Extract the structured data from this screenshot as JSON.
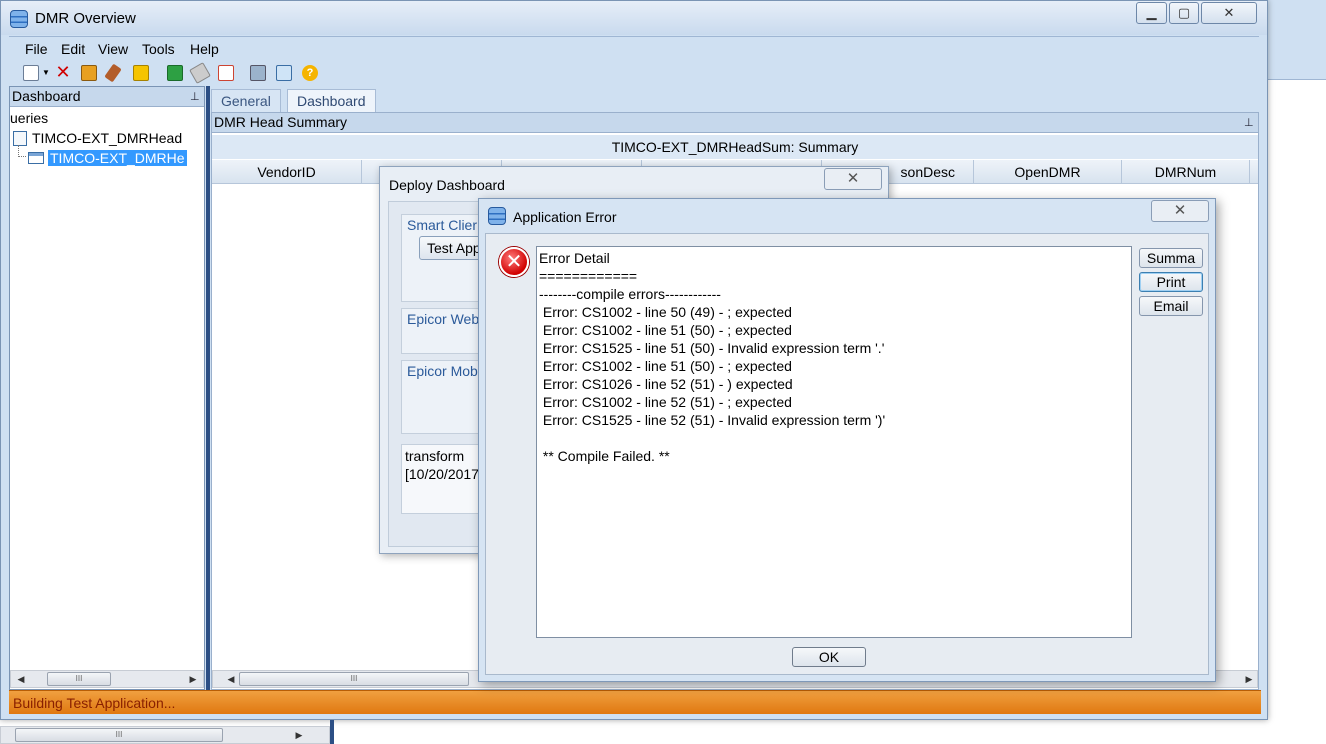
{
  "window": {
    "title": "DMR Overview"
  },
  "menu": [
    "File",
    "Edit",
    "View",
    "Tools",
    "Help"
  ],
  "toolbar_icons": [
    "new-icon",
    "delete-icon",
    "save-icon",
    "attach-icon",
    "open-folder-icon",
    "refresh-icon",
    "clear-icon",
    "edit-icon",
    "print-icon",
    "print-preview-icon",
    "help-icon"
  ],
  "left_pane": {
    "header": "Dashboard",
    "tree": [
      {
        "label": "ueries",
        "level": 0
      },
      {
        "label": "TIMCO-EXT_DMRHead",
        "level": 1
      },
      {
        "label": "TIMCO-EXT_DMRHe",
        "level": 2,
        "selected": true
      }
    ]
  },
  "tabs": [
    {
      "label": "General",
      "active": false
    },
    {
      "label": "Dashboard",
      "active": true
    }
  ],
  "summary": {
    "header": "DMR Head Summary",
    "caption": "TIMCO-EXT_DMRHeadSum: Summary",
    "columns": [
      "VendorID",
      "",
      "",
      "",
      "sonDesc",
      "OpenDMR",
      "DMRNum"
    ]
  },
  "status": {
    "text": "Building Test Application..."
  },
  "deploy_dialog": {
    "title": "Deploy Dashboard",
    "groups": [
      "Smart Clier",
      "Epicor Web",
      "Epicor Mob"
    ],
    "test_button": "Test App",
    "log_lines": [
      "transform",
      "[10/20/2017"
    ]
  },
  "error_dialog": {
    "title": "Application Error",
    "lines": [
      "Error Detail",
      "============",
      "--------compile errors------------",
      " Error: CS1002 - line 50 (49) - ; expected",
      " Error: CS1002 - line 51 (50) - ; expected",
      " Error: CS1525 - line 51 (50) - Invalid expression term '.'",
      " Error: CS1002 - line 51 (50) - ; expected",
      " Error: CS1026 - line 52 (51) - ) expected",
      " Error: CS1002 - line 52 (51) - ; expected",
      " Error: CS1525 - line 52 (51) - Invalid expression term ')'",
      "",
      " ** Compile Failed. **"
    ],
    "buttons": {
      "summary": "Summa",
      "print": "Print",
      "email": "Email",
      "ok": "OK"
    }
  },
  "colors": {
    "status_bar": "#e88a20",
    "selection": "#3399ff",
    "splitter": "#2c4f85"
  }
}
